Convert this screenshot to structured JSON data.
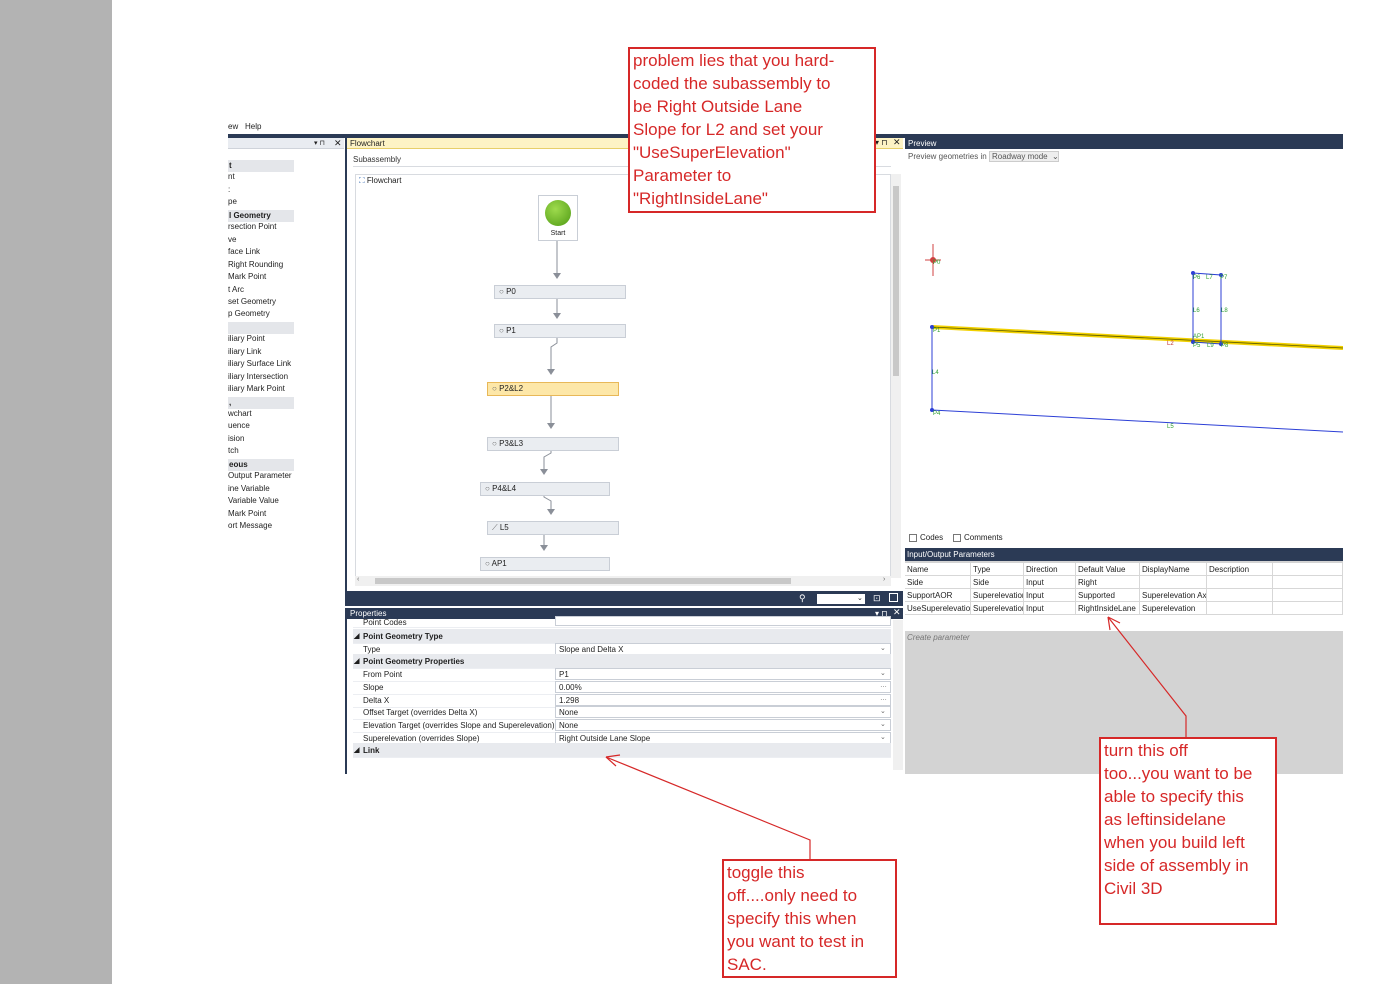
{
  "menubar": {
    "view_partial": "ew",
    "help": "Help"
  },
  "toolbox": {
    "items": [
      {
        "text": "t",
        "cat": true
      },
      {
        "text": "nt"
      },
      {
        "text": ":"
      },
      {
        "text": "pe"
      },
      {
        "text": "l Geometry",
        "cat": true
      },
      {
        "text": "rsection Point"
      },
      {
        "text": "ve"
      },
      {
        "text": "face Link"
      },
      {
        "text": "Right Rounding"
      },
      {
        "text": "Mark Point"
      },
      {
        "text": "t Arc"
      },
      {
        "text": "set Geometry"
      },
      {
        "text": "p Geometry"
      },
      {
        "text": "",
        "cat": true
      },
      {
        "text": "iliary Point"
      },
      {
        "text": "iliary Link"
      },
      {
        "text": "iliary Surface Link"
      },
      {
        "text": "iliary Intersection"
      },
      {
        "text": "iliary Mark Point"
      },
      {
        "text": ",",
        "cat": true
      },
      {
        "text": "wchart"
      },
      {
        "text": "uence"
      },
      {
        "text": "ision"
      },
      {
        "text": "tch"
      },
      {
        "text": "eous",
        "cat": true
      },
      {
        "text": "Output Parameter"
      },
      {
        "text": "ine Variable"
      },
      {
        "text": "Variable Value"
      },
      {
        "text": "Mark Point"
      },
      {
        "text": "ort Message"
      }
    ]
  },
  "flowchart": {
    "title": "Flowchart",
    "subassembly_label": "Subassembly",
    "flowchart_label": "Flowchart",
    "start_label": "Start",
    "nodes": [
      "P0",
      "P1",
      "P2&L2",
      "P3&L3",
      "P4&L4",
      "L5",
      "AP1"
    ]
  },
  "properties": {
    "title": "Properties",
    "rows": [
      {
        "name": "Point Codes",
        "value": "",
        "cat": false
      },
      {
        "name": "Point Geometry Type",
        "cat": true
      },
      {
        "name": "Type",
        "value": "Slope and Delta X"
      },
      {
        "name": "Point Geometry Properties",
        "cat": true
      },
      {
        "name": "From Point",
        "value": "P1"
      },
      {
        "name": "Slope",
        "value": "0.00%"
      },
      {
        "name": "Delta X",
        "value": "1.298"
      },
      {
        "name": "Offset Target (overrides Delta X)",
        "value": "None"
      },
      {
        "name": "Elevation Target (overrides Slope and Superelevation)",
        "value": "None"
      },
      {
        "name": "Superelevation (overrides Slope)",
        "value": "Right Outside Lane Slope"
      },
      {
        "name": "Link",
        "cat": true
      }
    ]
  },
  "preview": {
    "title": "Preview",
    "mode_label": "Preview geometries in",
    "mode_value": "Roadway mode",
    "codes_label": "Codes",
    "comments_label": "Comments",
    "labels": {
      "p0": "P0",
      "p1": "P1",
      "p4": "P4",
      "l4": "L4",
      "l5": "L5",
      "l2": "L2",
      "p6": "P6",
      "l7": "L7",
      "p7": "P7",
      "l6": "L6",
      "l8": "L8",
      "ap1": "AP1",
      "p5": "P5",
      "l9": "L9",
      "p8": "P8"
    }
  },
  "io_params": {
    "title": "Input/Output Parameters",
    "headers": [
      "Name",
      "Type",
      "Direction",
      "Default Value",
      "DisplayName",
      "Description"
    ],
    "rows": [
      [
        "Side",
        "Side",
        "Input",
        "Right",
        "",
        ""
      ],
      [
        "SupportAOR",
        "Superelevation",
        "Input",
        "Supported",
        "Superelevation Ax",
        ""
      ],
      [
        "UseSuperelevation",
        "Superelevation",
        "Input",
        "RightInsideLane",
        "Superelevation",
        ""
      ]
    ],
    "create_label": "Create parameter"
  },
  "annotations": {
    "top": [
      "problem lies that you hard-",
      "coded the subassembly to",
      "be Right Outside Lane",
      "Slope for L2 and set your",
      "\"UseSuperElevation\"",
      "Parameter to",
      "\"RightInsideLane\""
    ],
    "bottom_center": [
      "toggle this",
      "off....only need to",
      "specify this when",
      "you want to test in",
      "SAC."
    ],
    "bottom_right": [
      "turn this off",
      "too...you want to be",
      "able to specify this",
      "as leftinsidelane",
      "when you build left",
      "side of assembly in",
      "Civil 3D"
    ]
  },
  "colors": {
    "accent_dark": "#2b3a55",
    "annotation_red": "#d62828",
    "selection": "#fde7a8",
    "start_green": "#5aa51b",
    "yellow_line": "#f2d100",
    "blue_line": "#2c3fd6",
    "green_label": "#2e9e2e"
  }
}
